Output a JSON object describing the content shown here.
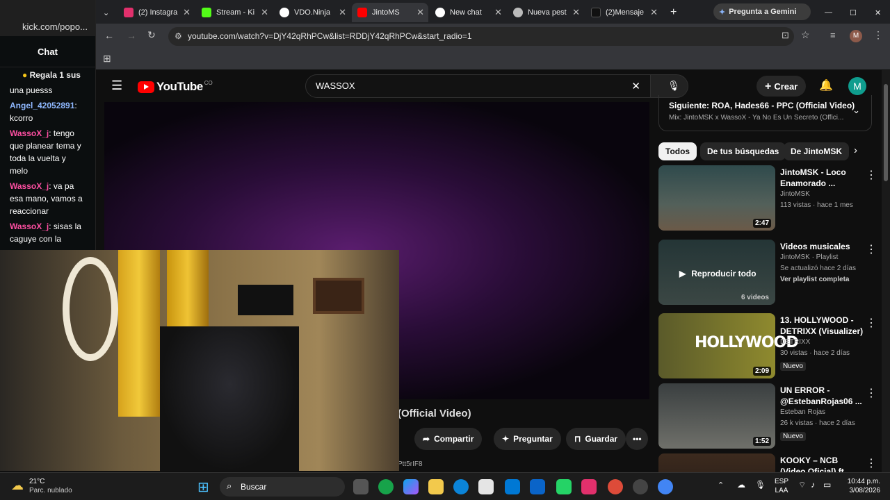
{
  "kick": {
    "url": "kick.com/popo...",
    "chat_title": "Chat",
    "gift_text": "Regala 1 sus",
    "messages": [
      {
        "user": "",
        "text": "una puesss"
      },
      {
        "user": "Angel_42052891",
        "text": "kcorro"
      },
      {
        "user": "WassoX_j",
        "text": "tengo que planear tema y toda la vuelta y melo"
      },
      {
        "user": "WassoX_j",
        "text": "va pa esa mano, vamos a reaccionar"
      },
      {
        "user": "WassoX_j",
        "text": "sisas la caguye con la"
      }
    ]
  },
  "tabs": [
    {
      "label": "(2) Instagra",
      "color": "#e1306c"
    },
    {
      "label": "Stream - Ki",
      "color": "#53fc18"
    },
    {
      "label": "VDO.Ninja",
      "color": "#ffffff"
    },
    {
      "label": "JintoMS",
      "color": "#ff0000"
    },
    {
      "label": "New chat",
      "color": "#ffffff"
    },
    {
      "label": "Nueva pest",
      "color": "#bbbbbb"
    },
    {
      "label": "(2)Mensaje",
      "color": "#111111"
    }
  ],
  "gemini_label": "Pregunta a Gemini",
  "url": "youtube.com/watch?v=DjY42qRhPCw&list=RDDjY42qRhPCw&start_radio=1",
  "youtube": {
    "logo": "YouTube",
    "country": "CO",
    "search_value": "WASSOX",
    "create_label": "Crear",
    "avatar_letter": "M",
    "next_label": "Siguiente: ROA, Hades66 - PPC (Official Video)",
    "mix_label": "Mix: JintoMSK x WassoX - Ya No Es Un Secreto (Offici...",
    "chips": [
      "Todos",
      "De tus búsquedas",
      "De JintoMSK"
    ],
    "actions": {
      "share": "Compartir",
      "ask": "Preguntar",
      "save": "Guardar"
    },
    "video_title_fragment": "(Official Video)",
    "url_fragment": "Ptt5rIF8",
    "recommendations": [
      {
        "title": "JintoMSK - Loco Enamorado ...",
        "channel": "JintoMSK",
        "meta": "113 vistas · hace 1 mes",
        "duration": "2:47",
        "badge": ""
      },
      {
        "title": "Videos musicales",
        "channel": "JintoMSK · Playlist",
        "meta": "Se actualizó hace 2 días",
        "duration": "6 videos",
        "badge": "Ver playlist completa",
        "overlay": "Reproducir todo"
      },
      {
        "title": "13. HOLLYWOOD - DETRIXX (Visualizer)",
        "channel": "DETRIXX",
        "meta": "30 vistas · hace 2 días",
        "duration": "2:09",
        "badge": "Nuevo",
        "thumb_text": "HOLLYWOOD"
      },
      {
        "title": "UN ERROR - @EstebanRojas06 ...",
        "channel": "Esteban Rojas",
        "meta": "26 k vistas · hace 2 días",
        "duration": "1:52",
        "badge": "Nuevo"
      },
      {
        "title": "KOOKY – NCB (Video Oficial) ft...",
        "channel": "",
        "meta": "",
        "duration": "",
        "badge": ""
      }
    ]
  },
  "taskbar": {
    "weather_temp": "21°C",
    "weather_desc": "Parc. nublado",
    "search_label": "Buscar",
    "lang": "ESP",
    "lang2": "LAA",
    "time": "10:44 p.m.",
    "date": "3/08/2026"
  }
}
